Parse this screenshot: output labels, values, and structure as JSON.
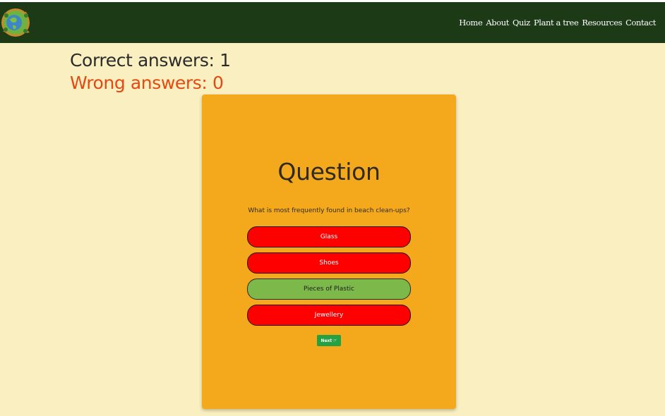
{
  "nav": {
    "links": [
      "Home",
      "About",
      "Quiz",
      "Plant a tree",
      "Resources",
      "Contact"
    ]
  },
  "score": {
    "correct_label": "Correct answers:",
    "correct_count": "1",
    "wrong_label": "Wrong answers:",
    "wrong_count": "0"
  },
  "quiz": {
    "title": "Question",
    "question": "What is most frequently found in beach clean-ups?",
    "answers": [
      {
        "label": "Glass",
        "state": "wrong"
      },
      {
        "label": "Shoes",
        "state": "wrong"
      },
      {
        "label": "Pieces of Plastic",
        "state": "correct"
      },
      {
        "label": "Jewellery",
        "state": "wrong"
      }
    ],
    "next_label": "Next",
    "next_icon": "hand-pointing-right-icon"
  },
  "colors": {
    "navbar": "#1D3A17",
    "page_background": "#FAEFC0",
    "card": "#F4A91C",
    "wrong_answer": "#FF0000",
    "correct_answer": "#7CB84A",
    "wrong_count_text": "#E34A12",
    "next_button": "#24A142"
  }
}
